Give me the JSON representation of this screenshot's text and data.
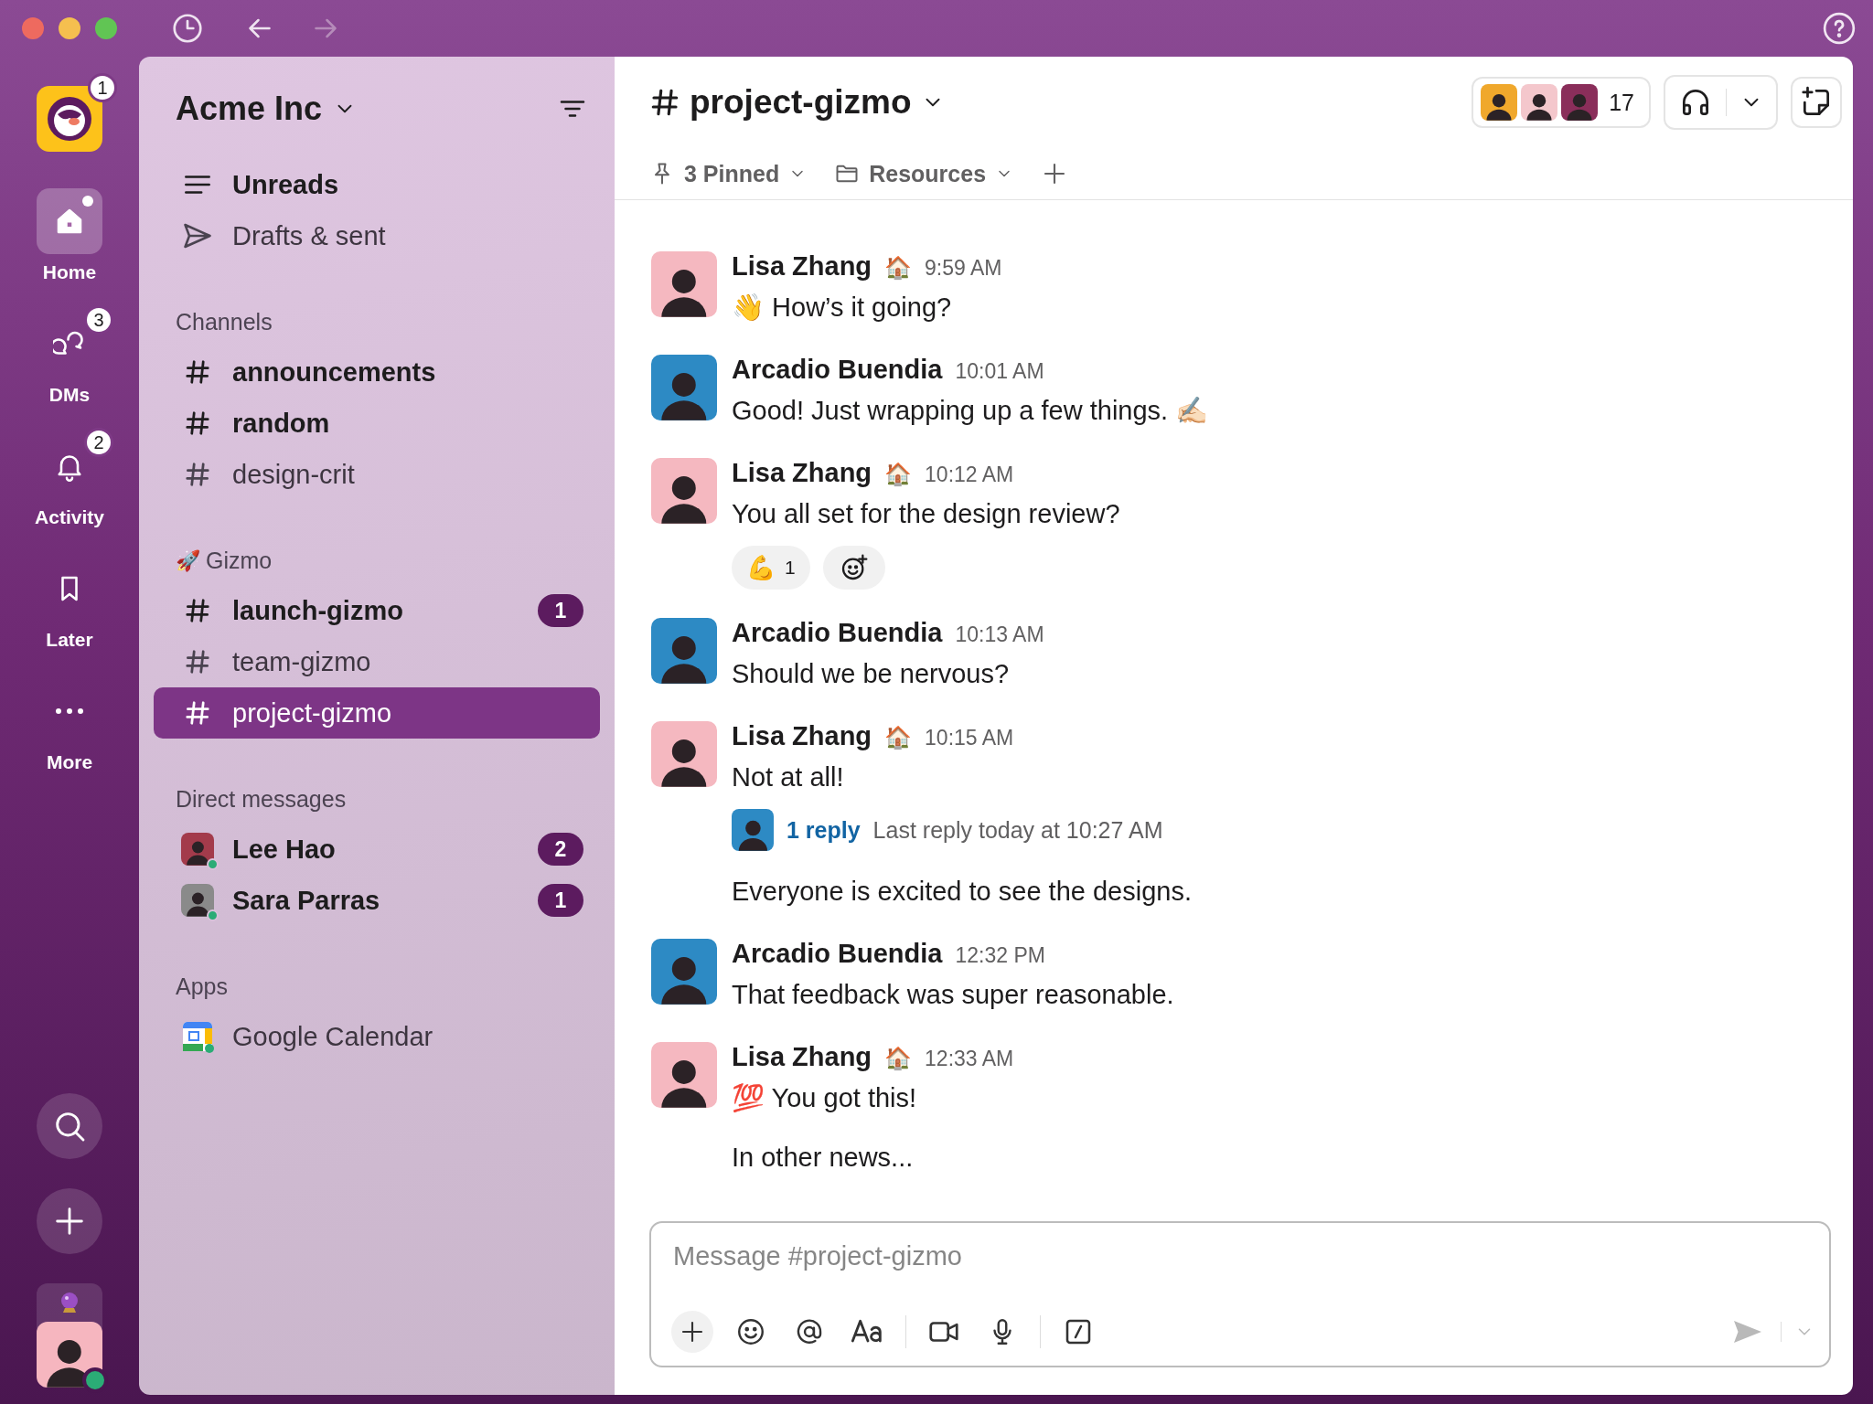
{
  "workspace": {
    "name": "Acme Inc",
    "badge": "1"
  },
  "rail": [
    {
      "kind": "home",
      "label": "Home",
      "selected": true
    },
    {
      "kind": "dms",
      "label": "DMs",
      "selected": false,
      "badge": "3"
    },
    {
      "kind": "activity",
      "label": "Activity",
      "selected": false,
      "badge": "2"
    },
    {
      "kind": "later",
      "label": "Later",
      "selected": false
    },
    {
      "kind": "more",
      "label": "More",
      "selected": false
    }
  ],
  "sidebar": {
    "top": [
      {
        "kind": "unreads",
        "label": "Unreads",
        "unread": true
      },
      {
        "kind": "drafts",
        "label": "Drafts & sent",
        "unread": false
      }
    ],
    "sections": [
      {
        "title": "Channels",
        "items": [
          {
            "kind": "channel",
            "label": "announcements",
            "unread": true,
            "selected": false
          },
          {
            "kind": "channel",
            "label": "random",
            "unread": true,
            "selected": false
          },
          {
            "kind": "channel",
            "label": "design-crit",
            "unread": false,
            "selected": false
          }
        ]
      },
      {
        "title": "Gizmo",
        "emoji": "🚀",
        "items": [
          {
            "kind": "channel",
            "label": "launch-gizmo",
            "unread": true,
            "selected": false,
            "badge": "1"
          },
          {
            "kind": "channel",
            "label": "team-gizmo",
            "unread": false,
            "selected": false
          },
          {
            "kind": "channel",
            "label": "project-gizmo",
            "unread": false,
            "selected": true
          }
        ]
      },
      {
        "title": "Direct messages",
        "items": [
          {
            "kind": "dm",
            "label": "Lee Hao",
            "unread": true,
            "selected": false,
            "badge": "2",
            "color": "#a33b4b"
          },
          {
            "kind": "dm",
            "label": "Sara Parras",
            "unread": true,
            "selected": false,
            "badge": "1",
            "color": "#8a8a8a"
          }
        ]
      },
      {
        "title": "Apps",
        "items": [
          {
            "kind": "app",
            "label": "Google Calendar",
            "unread": false,
            "selected": false
          }
        ]
      }
    ]
  },
  "channel": {
    "name": "project-gizmo",
    "member_count": "17",
    "tabs": [
      {
        "kind": "pinned",
        "label": "3 Pinned"
      },
      {
        "kind": "folder",
        "label": "Resources"
      }
    ]
  },
  "messages": [
    {
      "kind": "message",
      "author": "Lisa Zhang",
      "status": "🏠",
      "time": "9:59 AM",
      "color": "#f5b8c0",
      "text": "👋 How’s it going?"
    },
    {
      "kind": "message",
      "author": "Arcadio Buendia",
      "time": "10:01 AM",
      "color": "#2d8ac4",
      "text": "Good! Just wrapping up a few things. ✍🏻"
    },
    {
      "kind": "message",
      "author": "Lisa Zhang",
      "status": "🏠",
      "time": "10:12 AM",
      "color": "#f5b8c0",
      "text": "You all set for the design review?",
      "reactions": [
        {
          "emoji": "💪",
          "count": "1"
        }
      ]
    },
    {
      "kind": "message",
      "author": "Arcadio Buendia",
      "time": "10:13 AM",
      "color": "#2d8ac4",
      "text": "Should we be nervous?"
    },
    {
      "kind": "message",
      "author": "Lisa Zhang",
      "status": "🏠",
      "time": "10:15 AM",
      "color": "#f5b8c0",
      "text": "Not at all!",
      "thread": {
        "replies": "1 reply",
        "last": "Last reply today at 10:27 AM"
      }
    },
    {
      "kind": "continuation",
      "text": "Everyone is excited to see the designs."
    },
    {
      "kind": "message",
      "author": "Arcadio Buendia",
      "time": "12:32 PM",
      "color": "#2d8ac4",
      "text": "That feedback was super reasonable."
    },
    {
      "kind": "message",
      "author": "Lisa Zhang",
      "status": "🏠",
      "time": "12:33 AM",
      "color": "#f5b8c0",
      "text": "💯 You got this!"
    },
    {
      "kind": "continuation",
      "text": "In other news..."
    }
  ],
  "composer": {
    "placeholder": "Message #project-gizmo"
  }
}
